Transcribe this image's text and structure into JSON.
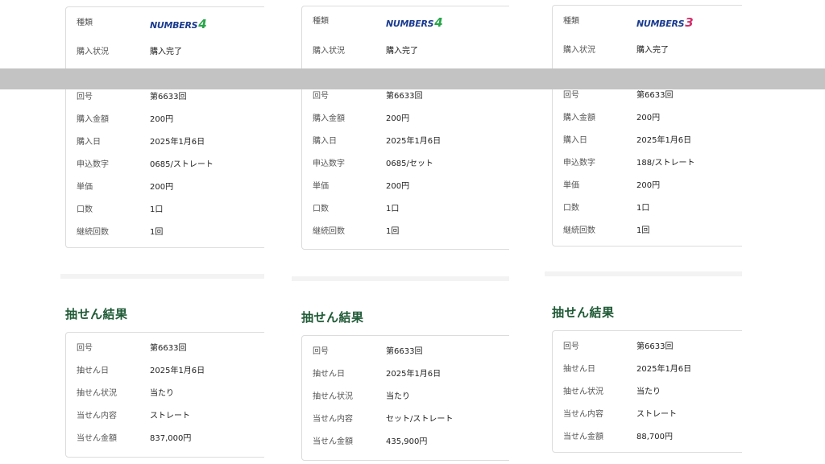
{
  "columns": [
    {
      "purchase": {
        "type_label": "種類",
        "game_logo": {
          "text": "NUMBERS",
          "number": "4"
        },
        "status_label": "購入状況",
        "status_value": "購入完了",
        "rows": [
          {
            "k": "回号",
            "v": "第6633回"
          },
          {
            "k": "購入金額",
            "v": "200円"
          },
          {
            "k": "購入日",
            "v": "2025年1月6日"
          },
          {
            "k": "申込数字",
            "v": "0685/ストレート"
          },
          {
            "k": "単価",
            "v": "200円"
          },
          {
            "k": "口数",
            "v": "1口"
          },
          {
            "k": "継続回数",
            "v": "1回"
          }
        ]
      },
      "result": {
        "title": "抽せん結果",
        "rows": [
          {
            "k": "回号",
            "v": "第6633回"
          },
          {
            "k": "抽せん日",
            "v": "2025年1月6日"
          },
          {
            "k": "抽せん状況",
            "v": "当たり"
          },
          {
            "k": "当せん内容",
            "v": "ストレート"
          },
          {
            "k": "当せん金額",
            "v": "837,000円"
          }
        ]
      }
    },
    {
      "purchase": {
        "type_label": "種類",
        "game_logo": {
          "text": "NUMBERS",
          "number": "4"
        },
        "status_label": "購入状況",
        "status_value": "購入完了",
        "rows": [
          {
            "k": "回号",
            "v": "第6633回"
          },
          {
            "k": "購入金額",
            "v": "200円"
          },
          {
            "k": "購入日",
            "v": "2025年1月6日"
          },
          {
            "k": "申込数字",
            "v": "0685/セット"
          },
          {
            "k": "単価",
            "v": "200円"
          },
          {
            "k": "口数",
            "v": "1口"
          },
          {
            "k": "継続回数",
            "v": "1回"
          }
        ]
      },
      "result": {
        "title": "抽せん結果",
        "rows": [
          {
            "k": "回号",
            "v": "第6633回"
          },
          {
            "k": "抽せん日",
            "v": "2025年1月6日"
          },
          {
            "k": "抽せん状況",
            "v": "当たり"
          },
          {
            "k": "当せん内容",
            "v": "セット/ストレート"
          },
          {
            "k": "当せん金額",
            "v": "435,900円"
          }
        ]
      }
    },
    {
      "purchase": {
        "type_label": "種類",
        "game_logo": {
          "text": "NUMBERS",
          "number": "3"
        },
        "status_label": "購入状況",
        "status_value": "購入完了",
        "rows": [
          {
            "k": "回号",
            "v": "第6633回"
          },
          {
            "k": "購入金額",
            "v": "200円"
          },
          {
            "k": "購入日",
            "v": "2025年1月6日"
          },
          {
            "k": "申込数字",
            "v": "188/ストレート"
          },
          {
            "k": "単価",
            "v": "200円"
          },
          {
            "k": "口数",
            "v": "1口"
          },
          {
            "k": "継続回数",
            "v": "1回"
          }
        ]
      },
      "result": {
        "title": "抽せん結果",
        "rows": [
          {
            "k": "回号",
            "v": "第6633回"
          },
          {
            "k": "抽せん日",
            "v": "2025年1月6日"
          },
          {
            "k": "抽せん状況",
            "v": "当たり"
          },
          {
            "k": "当せん内容",
            "v": "ストレート"
          },
          {
            "k": "当せん金額",
            "v": "88,700円"
          }
        ]
      }
    }
  ]
}
